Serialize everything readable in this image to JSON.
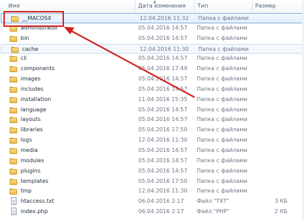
{
  "columns": {
    "name": "Имя",
    "date": "Дата изменения",
    "type": "Тип",
    "size": "Размер"
  },
  "files": [
    {
      "name": "__MACOSX",
      "date": "12.04.2016 11:32",
      "type": "Папка с файлами",
      "size": "",
      "kind": "folder",
      "state": "selected"
    },
    {
      "name": "administrator",
      "date": "05.04.2016 14:57",
      "type": "Папка с файлами",
      "size": "",
      "kind": "folder",
      "state": ""
    },
    {
      "name": "bin",
      "date": "05.04.2016 14:57",
      "type": "Папка с файлами",
      "size": "",
      "kind": "folder",
      "state": ""
    },
    {
      "name": "cache",
      "date": "12.04.2016 11:30",
      "type": "Папка с файлами",
      "size": "",
      "kind": "folder",
      "state": "hover"
    },
    {
      "name": "cli",
      "date": "05.04.2016 14:57",
      "type": "Папка с файлами",
      "size": "",
      "kind": "folder",
      "state": ""
    },
    {
      "name": "components",
      "date": "05.04.2016 17:49",
      "type": "Папка с файлами",
      "size": "",
      "kind": "folder",
      "state": ""
    },
    {
      "name": "images",
      "date": "05.04.2016 14:57",
      "type": "Папка с файлами",
      "size": "",
      "kind": "folder",
      "state": ""
    },
    {
      "name": "includes",
      "date": "05.04.2016 14:57",
      "type": "Папка с файлами",
      "size": "",
      "kind": "folder",
      "state": ""
    },
    {
      "name": "installation",
      "date": "11.04.2016 15:35",
      "type": "Папка с файлами",
      "size": "",
      "kind": "folder",
      "state": ""
    },
    {
      "name": "language",
      "date": "05.04.2016 14:57",
      "type": "Папка с файлами",
      "size": "",
      "kind": "folder",
      "state": ""
    },
    {
      "name": "layouts",
      "date": "05.04.2016 14:57",
      "type": "Папка с файлами",
      "size": "",
      "kind": "folder",
      "state": ""
    },
    {
      "name": "libraries",
      "date": "05.04.2016 17:50",
      "type": "Папка с файлами",
      "size": "",
      "kind": "folder",
      "state": ""
    },
    {
      "name": "logs",
      "date": "12.04.2016 11:30",
      "type": "Папка с файлами",
      "size": "",
      "kind": "folder",
      "state": ""
    },
    {
      "name": "media",
      "date": "05.04.2016 14:57",
      "type": "Папка с файлами",
      "size": "",
      "kind": "folder",
      "state": ""
    },
    {
      "name": "modules",
      "date": "05.04.2016 14:57",
      "type": "Папка с файлами",
      "size": "",
      "kind": "folder",
      "state": ""
    },
    {
      "name": "plugins",
      "date": "05.04.2016 14:57",
      "type": "Папка с файлами",
      "size": "",
      "kind": "folder",
      "state": ""
    },
    {
      "name": "templates",
      "date": "05.04.2016 17:50",
      "type": "Папка с файлами",
      "size": "",
      "kind": "folder",
      "state": ""
    },
    {
      "name": "tmp",
      "date": "12.04.2016 11:30",
      "type": "Папка с файлами",
      "size": "",
      "kind": "folder",
      "state": ""
    },
    {
      "name": "htaccess.txt",
      "date": "06.04.2016 2:17",
      "type": "Файл \"TXT\"",
      "size": "3 КБ",
      "kind": "file",
      "state": ""
    },
    {
      "name": "index.php",
      "date": "06.04.2016 2:17",
      "type": "Файл \"PHP\"",
      "size": "2 КБ",
      "kind": "file",
      "state": ""
    }
  ],
  "colors": {
    "annotation": "#d21f1f",
    "selection_border": "#84acdd",
    "folder": "#f8dc84"
  }
}
